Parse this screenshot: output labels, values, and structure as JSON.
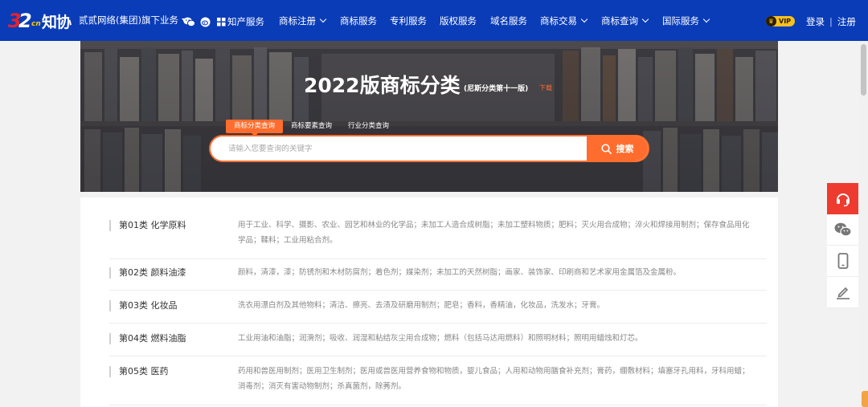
{
  "nav": {
    "group": "贰贰网络(集团)旗下业务",
    "zhichan": "知产服务",
    "items": [
      {
        "label": "商标注册",
        "dropdown": true
      },
      {
        "label": "商标服务",
        "dropdown": false
      },
      {
        "label": "专利服务",
        "dropdown": false
      },
      {
        "label": "版权服务",
        "dropdown": false
      },
      {
        "label": "域名服务",
        "dropdown": false
      },
      {
        "label": "商标交易",
        "dropdown": true
      },
      {
        "label": "商标查询",
        "dropdown": true
      },
      {
        "label": "国际服务",
        "dropdown": true
      }
    ],
    "vip": "VIP",
    "login": "登录",
    "separator": "|",
    "register": "注册"
  },
  "hero": {
    "title": "2022版商标分类",
    "subtitle": "(尼斯分类第十一版)",
    "download": "下载",
    "tabs": [
      "商标分类查询",
      "商标要素查询",
      "行业分类查询"
    ],
    "active_tab": 0,
    "search_placeholder": "请输入您要查询的关键字",
    "search_button": "搜索"
  },
  "classes": [
    {
      "name": "第01类 化学原料",
      "desc": "用于工业、科学、摄影、农业、园艺和林业的化学品；未加工人造合成树脂；未加工塑料物质；肥料；灭火用合成物；淬火和焊接用制剂；保存食品用化学品；鞣料；工业用粘合剂。"
    },
    {
      "name": "第02类 颜料油漆",
      "desc": "颜料，清漆，漆；防锈剂和木材防腐剂；着色剂；媒染剂；未加工的天然树脂；画家、装饰家、印刷商和艺术家用金属箔及金属粉。"
    },
    {
      "name": "第03类 化妆品",
      "desc": "洗衣用漂白剂及其他物料；清洁、擦亮、去渍及研磨用制剂；肥皂；香料，香精油，化妆品，洗发水；牙膏。"
    },
    {
      "name": "第04类 燃料油脂",
      "desc": "工业用油和油脂；润滑剂；吸收、润湿和粘结灰尘用合成物；燃料（包括马达用燃料）和照明材料；照明用蜡烛和灯芯。"
    },
    {
      "name": "第05类 医药",
      "desc": "药用和兽医用制剂；医用卫生制剂；医用或兽医用营养食物和物质，婴儿食品；人用和动物用膳食补充剂；膏药，绷敷材料；填塞牙孔用料，牙科用蜡；消毒剂；消灭有害动物制剂；杀真菌剂，除莠剂。"
    }
  ],
  "colors": {
    "nav_bg": "#0a3cb8",
    "accent": "#ff6d2e",
    "float_red": "#ee3b2f"
  },
  "icons": [
    "wechat-icon",
    "weibo-icon",
    "crown-icon",
    "search-icon",
    "headset-icon",
    "mobile-icon",
    "edit-icon"
  ]
}
